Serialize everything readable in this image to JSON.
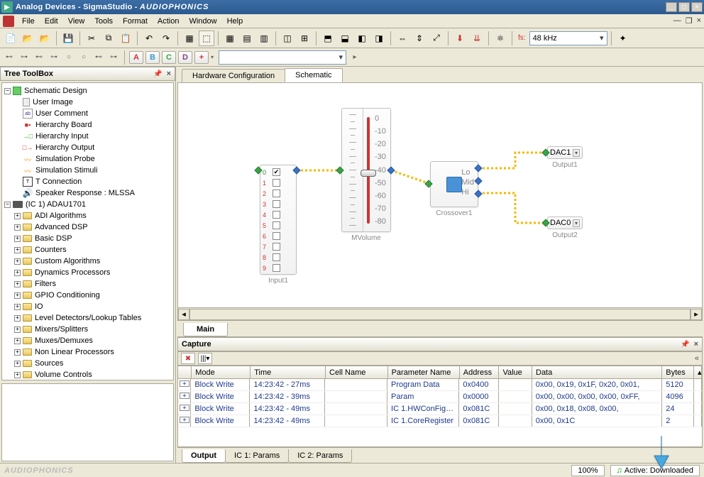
{
  "window": {
    "title_prefix": "Analog Devices - SigmaStudio - ",
    "brand": "AUDIOPHONICS"
  },
  "menu": [
    "File",
    "Edit",
    "View",
    "Tools",
    "Format",
    "Action",
    "Window",
    "Help"
  ],
  "sample_rate": {
    "label": "fs:",
    "value": "48 kHz"
  },
  "toolbar2_letters": [
    "A",
    "B",
    "C",
    "D",
    "+"
  ],
  "tree": {
    "title": "Tree ToolBox",
    "root1": {
      "label": "Schematic Design",
      "children": [
        {
          "label": "User Image",
          "icon": "doc"
        },
        {
          "label": "User Comment",
          "icon": "abl"
        },
        {
          "label": "Hierarchy Board",
          "icon": "hier"
        },
        {
          "label": "Hierarchy Input",
          "icon": "hin"
        },
        {
          "label": "Hierarchy Output",
          "icon": "hout"
        },
        {
          "label": "Simulation Probe",
          "icon": "sim"
        },
        {
          "label": "Simulation Stimuli",
          "icon": "sim"
        },
        {
          "label": "T Connection",
          "icon": "tc"
        },
        {
          "label": "Speaker Response : MLSSA",
          "icon": "sp"
        }
      ]
    },
    "root2": {
      "label": "(IC 1) ADAU1701",
      "children": [
        "ADI Algorithms",
        "Advanced DSP",
        "Basic DSP",
        "Counters",
        "Custom Algorithms",
        "Dynamics Processors",
        "Filters",
        "GPIO Conditioning",
        "IO",
        "Level Detectors/Lookup Tables",
        "Mixers/Splitters",
        "Muxes/Demuxes",
        "Non Linear Processors",
        "Sources",
        "Volume Controls"
      ]
    }
  },
  "tabs": {
    "items": [
      "Hardware Configuration",
      "Schematic"
    ],
    "active": 1
  },
  "schematic": {
    "input": {
      "label": "Input1",
      "rows": [
        0,
        1,
        2,
        3,
        4,
        5,
        6,
        7,
        8,
        9
      ],
      "checked": [
        true,
        false,
        false,
        false,
        false,
        false,
        false,
        false,
        false,
        false
      ]
    },
    "volume": {
      "label": "MVolume",
      "ticks": [
        "0",
        "-10",
        "-20",
        "-30",
        "-40",
        "-50",
        "-60",
        "-70",
        "-80"
      ]
    },
    "crossover": {
      "label": "Crossover1",
      "outs": [
        "Lo",
        "Mid",
        "Hi"
      ]
    },
    "outputs": [
      {
        "label": "DAC1",
        "caption": "Output1"
      },
      {
        "label": "DAC0",
        "caption": "Output2"
      }
    ],
    "main_tab": "Main"
  },
  "capture": {
    "title": "Capture",
    "columns": [
      "Mode",
      "Time",
      "Cell Name",
      "Parameter Name",
      "Address",
      "Value",
      "Data",
      "Bytes"
    ],
    "rows": [
      {
        "mode": "Block Write",
        "time": "14:23:42 - 27ms",
        "cell": "",
        "param": "Program Data",
        "addr": "0x0400",
        "value": "",
        "data": "0x00, 0x19, 0x1F, 0x20, 0x01,",
        "bytes": "5120"
      },
      {
        "mode": "Block Write",
        "time": "14:23:42 - 39ms",
        "cell": "",
        "param": "Param",
        "addr": "0x0000",
        "value": "",
        "data": "0x00, 0x00, 0x00, 0x00, 0xFF,",
        "bytes": "4096"
      },
      {
        "mode": "Block Write",
        "time": "14:23:42 - 49ms",
        "cell": "",
        "param": "IC 1.HWConFig…",
        "addr": "0x081C",
        "value": "",
        "data": "0x00, 0x18, 0x08, 0x00,",
        "bytes": "24"
      },
      {
        "mode": "Block Write",
        "time": "14:23:42 - 49ms",
        "cell": "",
        "param": "IC 1.CoreRegister",
        "addr": "0x081C",
        "value": "",
        "data": "0x00, 0x1C",
        "bytes": "2"
      }
    ],
    "bottom_tabs": [
      "Output",
      "IC 1: Params",
      "IC 2: Params"
    ],
    "active_bottom": 0
  },
  "status": {
    "zoom": "100%",
    "state": "Active: Downloaded"
  }
}
